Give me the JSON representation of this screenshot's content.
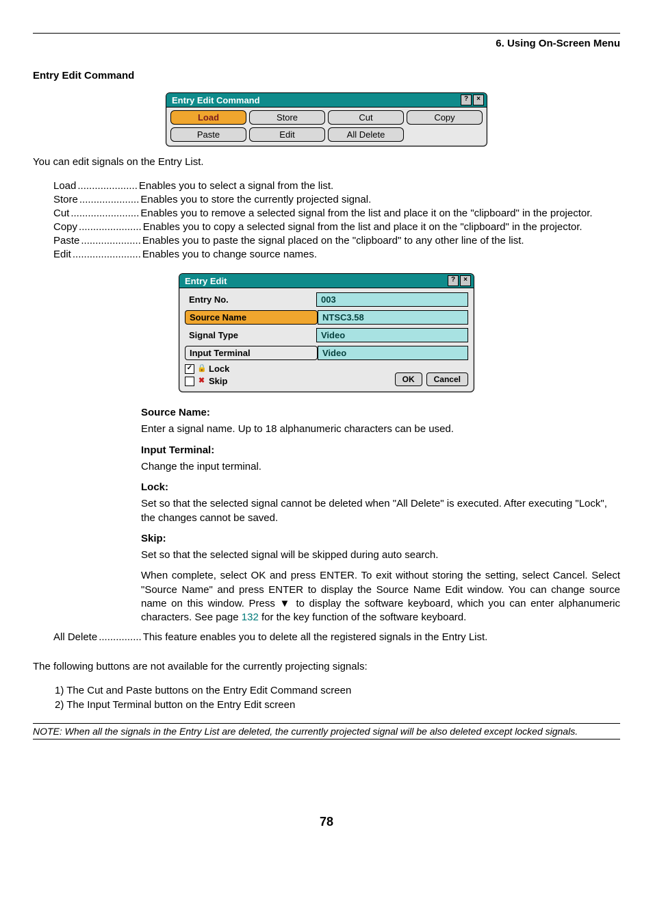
{
  "headerSection": "6. Using On-Screen Menu",
  "sectionHeading": "Entry Edit Command",
  "dlgCmd": {
    "title": "Entry Edit Command",
    "buttons": [
      "Load",
      "Store",
      "Cut",
      "Copy",
      "Paste",
      "Edit",
      "All Delete"
    ]
  },
  "introPara": "You can edit signals on the Entry List.",
  "defs": [
    {
      "term": "Load",
      "dots": ".....................",
      "desc": "Enables you to select a signal from the list."
    },
    {
      "term": "Store",
      "dots": ".....................",
      "desc": "Enables you to store the currently projected signal."
    },
    {
      "term": "Cut",
      "dots": "........................",
      "desc": "Enables you to remove a selected signal from the list and place it on the \"clipboard\" in the projector."
    },
    {
      "term": "Copy",
      "dots": "......................",
      "desc": "Enables you to copy a selected signal from the list and place it on the \"clipboard\" in the projector."
    },
    {
      "term": "Paste",
      "dots": ".....................",
      "desc": "Enables you to paste the signal placed on the \"clipboard\" to any other line of the list."
    },
    {
      "term": "Edit",
      "dots": "........................",
      "desc": "Enables you to change source names."
    }
  ],
  "dlgEdit": {
    "title": "Entry Edit",
    "rows": {
      "entryNoLabel": "Entry No.",
      "entryNoVal": "003",
      "sourceNameLabel": "Source Name",
      "sourceNameVal": "NTSC3.58",
      "signalTypeLabel": "Signal Type",
      "signalTypeVal": "Video",
      "inputTerminalLabel": "Input Terminal",
      "inputTerminalVal": "Video"
    },
    "lockLabel": "Lock",
    "skipLabel": "Skip",
    "ok": "OK",
    "cancel": "Cancel"
  },
  "descBlock": {
    "sourceNameH": "Source Name:",
    "sourceNameP": "Enter a signal name. Up to 18 alphanumeric characters can be used.",
    "inputTerminalH": "Input Terminal:",
    "inputTerminalP": "Change the input terminal.",
    "lockH": "Lock:",
    "lockP": "Set so that the selected signal cannot be deleted when \"All Delete\" is executed. After executing \"Lock\", the changes cannot be saved.",
    "skipH": "Skip:",
    "skipP": "Set so that the selected signal will be skipped during auto search.",
    "completeP_a": "When complete, select OK and press ENTER. To exit without storing the setting, select Cancel. Select \"Source Name\" and press ENTER to display the Source Name Edit window. You can change source name on this window. Press ▼ to display the software keyboard, which you can enter alphanumeric characters. See page ",
    "completeP_link": "132",
    "completeP_b": " for the key function of the software keyboard."
  },
  "allDelete": {
    "term": "All Delete",
    "dots": "...............",
    "desc": "This feature enables you to delete all the registered signals in the Entry List."
  },
  "unavailPara": "The following buttons are not available for the currently projecting signals:",
  "unavailList": [
    "1)  The Cut and Paste buttons on the Entry Edit Command screen",
    "2)  The Input Terminal button on the Entry Edit screen"
  ],
  "note": "NOTE: When all the signals in the Entry List are deleted, the currently projected signal will be also deleted except locked signals.",
  "pageNum": "78"
}
